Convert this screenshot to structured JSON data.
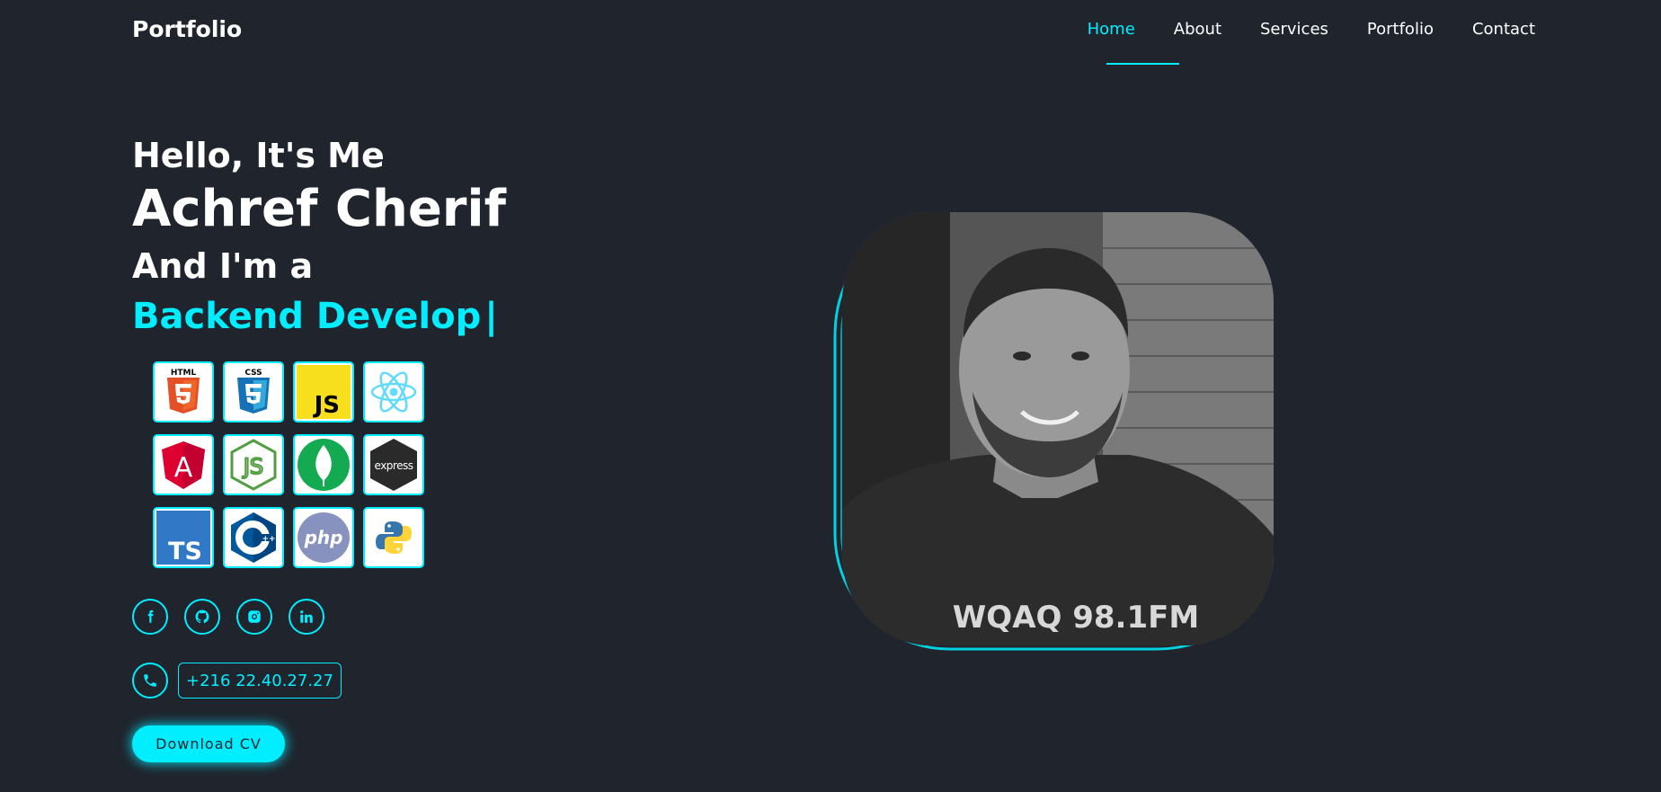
{
  "header": {
    "logo": "Portfolio",
    "nav": [
      {
        "label": "Home",
        "active": true
      },
      {
        "label": "About",
        "active": false
      },
      {
        "label": "Services",
        "active": false
      },
      {
        "label": "Portfolio",
        "active": false
      },
      {
        "label": "Contact",
        "active": false
      }
    ]
  },
  "hero": {
    "greeting": "Hello, It's Me",
    "name": "Achref Cherif",
    "intro": "And I'm a",
    "role": "Backend Develop",
    "cursor": "|"
  },
  "tech_icons": [
    {
      "icon": "html5-icon",
      "label": "HTML"
    },
    {
      "icon": "css3-icon",
      "label": "CSS"
    },
    {
      "icon": "javascript-icon",
      "label": "JS"
    },
    {
      "icon": "react-icon"
    },
    {
      "icon": "angular-icon",
      "label": "A"
    },
    {
      "icon": "nodejs-icon",
      "label": "JS"
    },
    {
      "icon": "mongodb-icon"
    },
    {
      "icon": "express-icon",
      "label": "express"
    },
    {
      "icon": "typescript-icon",
      "label": "TS"
    },
    {
      "icon": "cplusplus-icon",
      "label": "++"
    },
    {
      "icon": "php-icon",
      "label": "php"
    },
    {
      "icon": "python-icon"
    }
  ],
  "socials": [
    "facebook-icon",
    "github-icon",
    "instagram-icon",
    "linkedin-icon"
  ],
  "phone": {
    "icon": "phone-icon",
    "number": "+216 22.40.27.27"
  },
  "cv_button": "Download CV",
  "colors": {
    "background": "#1f242d",
    "accent": "#00eeff",
    "text": "#ffffff"
  }
}
